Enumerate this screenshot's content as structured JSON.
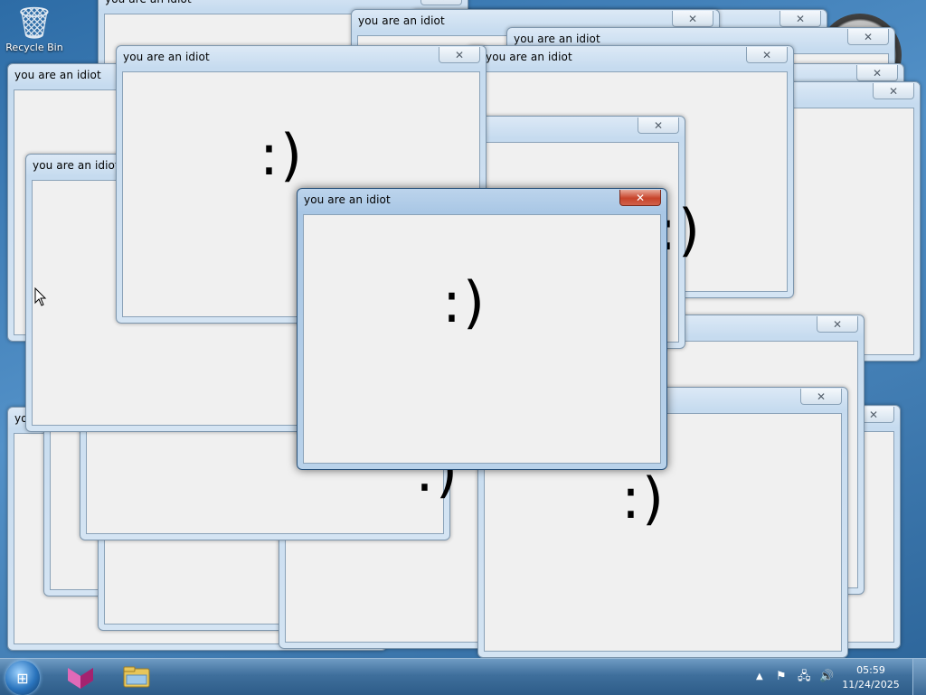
{
  "desktop": {
    "recycle_bin_label": "Recycle Bin",
    "recycle_bin_icon": "recycle-bin-icon",
    "clock_gadget_icon": "clock-gadget-icon"
  },
  "popup": {
    "title": "you are an idiot",
    "content": ":)"
  },
  "taskbar": {
    "start_icon": "windows-start-icon",
    "pinned": [
      "app-icon",
      "windows-explorer-icon"
    ],
    "tray_icons": [
      "show-hidden-icons-chevron-icon",
      "action-center-flag-icon",
      "network-icon",
      "volume-icon"
    ],
    "time": "05:59",
    "date": "11/24/2025"
  },
  "colors": {
    "active_close": "#c7432a",
    "window_frame": "#c6dbef",
    "client_bg": "#f0f0f0"
  }
}
